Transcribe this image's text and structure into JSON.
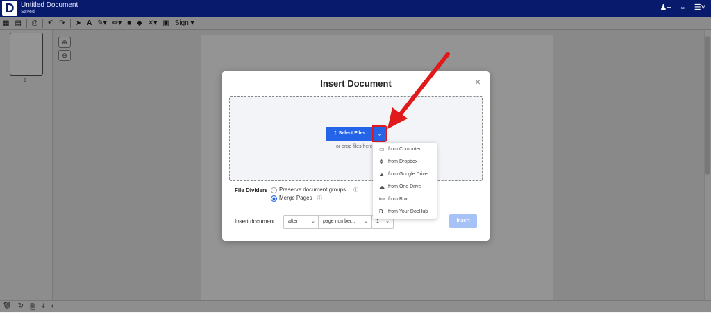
{
  "app": {
    "title": "Untitled Document",
    "status": "Saved",
    "logo": "D"
  },
  "top_icons": [
    "add-user-icon",
    "download-icon",
    "menu-icon"
  ],
  "toolbar": {
    "sign_label": "Sign"
  },
  "sidebar": {
    "page_number": "1"
  },
  "modal": {
    "title": "Insert Document",
    "close": "×",
    "select_files_label": "Select Files",
    "drop_text": "or drop files here",
    "sources": [
      {
        "label": "from Computer",
        "icon": "computer-icon"
      },
      {
        "label": "from Dropbox",
        "icon": "dropbox-icon"
      },
      {
        "label": "from Google Drive",
        "icon": "google-drive-icon"
      },
      {
        "label": "from One Drive",
        "icon": "onedrive-icon"
      },
      {
        "label": "from Box",
        "icon": "box-icon"
      },
      {
        "label": "from Your DocHub",
        "icon": "dochub-icon"
      }
    ],
    "file_dividers_label": "File Dividers",
    "option_preserve": "Preserve document groups",
    "option_merge": "Merge Pages",
    "selected_option": "Merge Pages",
    "insert_document_label": "Insert document",
    "position_value": "after",
    "target_value": "page number...",
    "page_value": "1",
    "insert_button": "Insert"
  },
  "colors": {
    "topbar": "#071a6b",
    "primary": "#2364e8",
    "insert_disabled": "#a7c2f7",
    "highlight": "#e01a1a"
  }
}
